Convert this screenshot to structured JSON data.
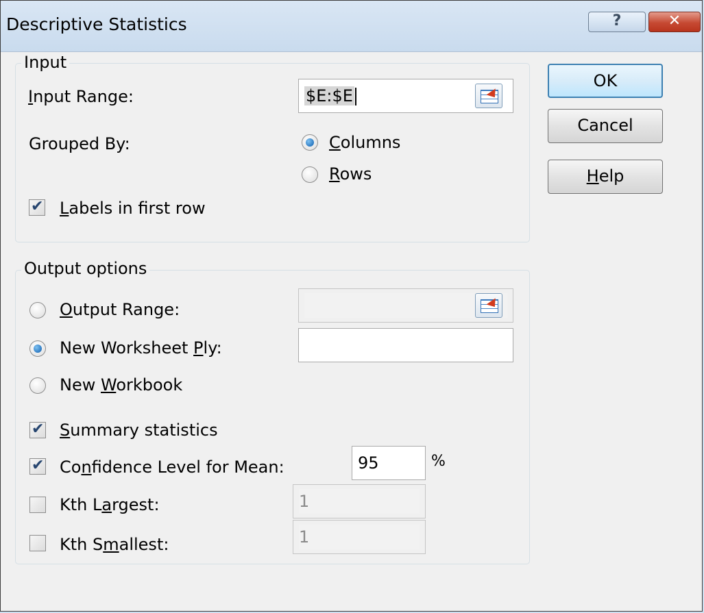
{
  "window": {
    "title": "Descriptive Statistics",
    "help_glyph": "?",
    "close_glyph": "✕"
  },
  "input_group": {
    "legend": "Input",
    "input_range_label": "Input Range:",
    "input_range_value": "$E:$E",
    "grouped_by_label": "Grouped By:",
    "columns_label": "Columns",
    "rows_label": "Rows",
    "grouped_by_selected": "Columns",
    "labels_first_row_label": "Labels in first row",
    "labels_first_row_checked": true
  },
  "output_group": {
    "legend": "Output options",
    "output_range_label": "Output Range:",
    "output_range_value": "",
    "new_worksheet_label": "New Worksheet Ply:",
    "new_worksheet_value": "",
    "new_workbook_label": "New Workbook",
    "selected_option": "New Worksheet Ply",
    "summary_label": "Summary statistics",
    "summary_checked": true,
    "confidence_label": "Confidence Level for Mean:",
    "confidence_checked": true,
    "confidence_value": "95",
    "confidence_unit": "%",
    "kth_largest_label": "Kth Largest:",
    "kth_largest_checked": false,
    "kth_largest_value": "1",
    "kth_smallest_label": "Kth Smallest:",
    "kth_smallest_checked": false,
    "kth_smallest_value": "1"
  },
  "buttons": {
    "ok": "OK",
    "cancel": "Cancel",
    "help": "Help"
  }
}
